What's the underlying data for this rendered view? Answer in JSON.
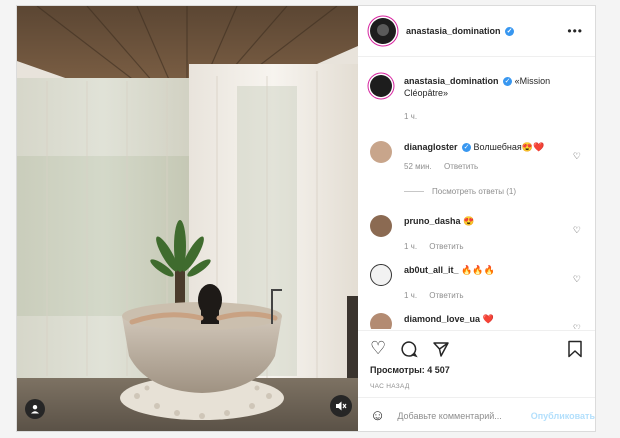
{
  "header": {
    "username": "anastasia_domination",
    "verified_icon": "verified-check-icon"
  },
  "caption": {
    "username": "anastasia_domination",
    "text": "«Mission Cléopâtre»",
    "time": "1 ч."
  },
  "comments": [
    {
      "username": "dianagloster",
      "text": "Волшебная😍❤️",
      "time": "52 мин.",
      "reply": "Ответить",
      "view_replies": "Посмотреть ответы (1)"
    },
    {
      "username": "pruno_dasha",
      "text": "😍",
      "time": "1 ч.",
      "reply": "Ответить"
    },
    {
      "username": "ab0ut_all_it_",
      "text": "🔥🔥🔥",
      "time": "1 ч.",
      "reply": "Ответить"
    },
    {
      "username": "diamond_love_ua",
      "text": "❤️"
    }
  ],
  "stats": {
    "views_label": "Просмотры: 4 507",
    "posted_ago": "ЧАС НАЗАД"
  },
  "comment_box": {
    "placeholder": "Добавьте комментарий...",
    "publish_label": "Опубликовать"
  },
  "colors": {
    "verified": "#3897f0",
    "heart": "#e0245e",
    "publish": "#b2dffc",
    "story_ring": "#d6249f"
  }
}
